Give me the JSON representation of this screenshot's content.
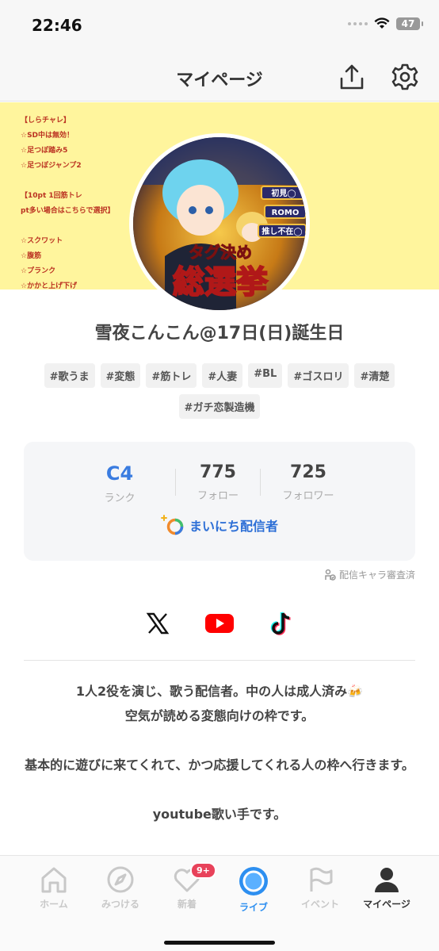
{
  "status": {
    "time": "22:46",
    "battery": "47"
  },
  "header": {
    "title": "マイページ"
  },
  "banner": {
    "notes": [
      "【しらチャレ】",
      "☆SD中は無効！",
      "☆足つぼ踏み5",
      "☆足つぼジャンプ2",
      "",
      "【10pt 1回筋トレ",
      "pt多い場合はこちらで選択】",
      "",
      "☆スクワット",
      "☆腹筋",
      "☆プランク",
      "☆かかと上げ下げ"
    ],
    "avatar_lines": [
      "タグ決め",
      "総選挙",
      "初見◯",
      "ROMO",
      "推し不在◯"
    ]
  },
  "profile": {
    "name": "雪夜こんこん@17日(日)誕生日",
    "tags": [
      "#歌うま",
      "#変態",
      "#筋トレ",
      "#人妻",
      "#BL",
      "#ゴスロリ",
      "#清楚",
      "#ガチ恋製造機"
    ]
  },
  "stats": {
    "rank_value": "C4",
    "rank_label": "ランク",
    "follow_value": "775",
    "follow_label": "フォロー",
    "follower_value": "725",
    "follower_label": "フォロワー",
    "daily_badge": "まいにち配信者"
  },
  "review_note": "配信キャラ審査済",
  "bio": [
    "1人2役を演じ、歌う配信者。中の人は成人済み🍻",
    "空気が読める変態向けの枠です。",
    "",
    "基本的に遊びに来てくれて、かつ応援してくれる人の枠へ行きます。",
    "",
    "youtube歌い手です。"
  ],
  "tabs": [
    {
      "label": "ホーム",
      "icon": "home-icon"
    },
    {
      "label": "みつける",
      "icon": "compass-icon"
    },
    {
      "label": "新着",
      "icon": "heart-icon",
      "badge": "9+"
    },
    {
      "label": "ライブ",
      "icon": "live-icon"
    },
    {
      "label": "イベント",
      "icon": "flag-icon"
    },
    {
      "label": "マイページ",
      "icon": "person-icon"
    }
  ],
  "colors": {
    "accent": "#3a7ce0",
    "banner_bg": "#fff59d",
    "badge": "#e8425a"
  }
}
